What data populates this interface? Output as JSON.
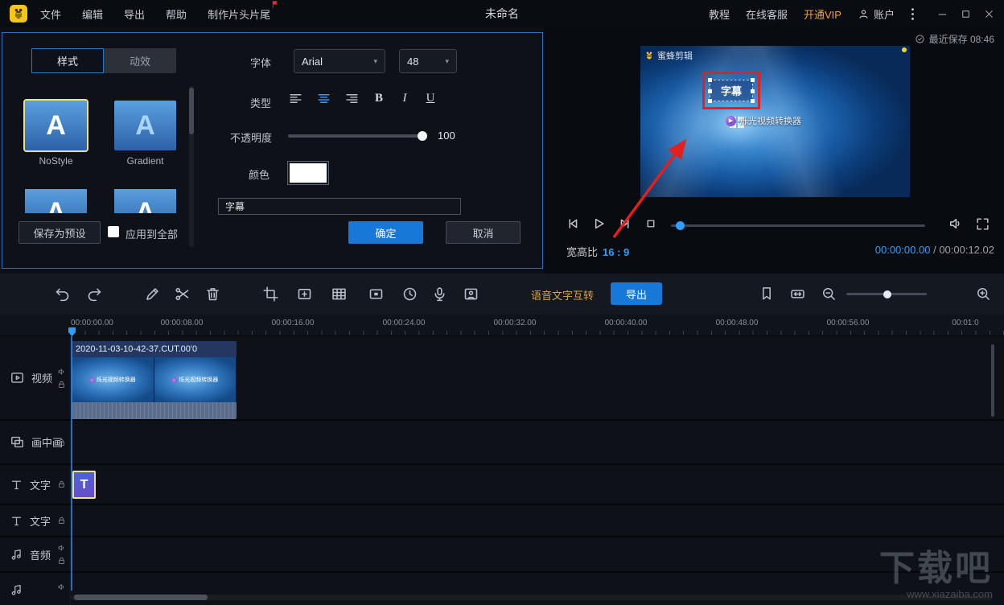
{
  "topbar": {
    "menu": [
      {
        "label": "文件"
      },
      {
        "label": "编辑"
      },
      {
        "label": "导出"
      },
      {
        "label": "帮助"
      },
      {
        "label": "制作片头片尾"
      }
    ],
    "title": "未命名",
    "tutorial": "教程",
    "support": "在线客服",
    "vip": "开通VIP",
    "account": "账户"
  },
  "style_panel": {
    "tabs": [
      {
        "label": "样式"
      },
      {
        "label": "动效"
      }
    ],
    "presets": [
      {
        "label": "NoStyle",
        "letter": "A"
      },
      {
        "label": "Gradient",
        "letter": "A"
      }
    ],
    "font_label": "字体",
    "font_value": "Arial",
    "font_size": "48",
    "type_label": "类型",
    "bold_label": "B",
    "italic_label": "I",
    "underline_label": "U",
    "opacity_label": "不透明度",
    "opacity_value": "100",
    "color_label": "颜色",
    "text_content": "字幕",
    "save_preset_label": "保存为预设",
    "apply_all_label": "应用到全部",
    "ok_label": "确定",
    "cancel_label": "取消"
  },
  "preview": {
    "saved_text": "最近保存 08:46",
    "brand_watermark": "蜜蜂剪辑",
    "subtitle_text": "字幕",
    "clip_overlay_text": "烁光视频转换器",
    "aspect_label": "宽高比",
    "aspect_value": "16 : 9",
    "time_current": "00:00:00.00",
    "time_separator": "/",
    "time_total": "00:00:12.02"
  },
  "toolbar": {
    "speech_label": "语音文字互转",
    "export_label": "导出"
  },
  "timeline": {
    "ruler": [
      "00:00:00.00",
      "00:00:08.00",
      "00:00:16.00",
      "00:00:24.00",
      "00:00:32.00",
      "00:00:40.00",
      "00:00:48.00",
      "00:00:56.00",
      "00:01:0"
    ],
    "tracks": [
      {
        "label": "视频"
      },
      {
        "label": "画中画"
      },
      {
        "label": "文字"
      },
      {
        "label": "文字"
      },
      {
        "label": "音频"
      }
    ],
    "video_clip_title": "2020-11-03-10-42-37.CUT.00'0",
    "text_clip_letter": "T"
  },
  "watermark": {
    "title": "下载吧",
    "url": "www.xiazaiba.com"
  }
}
